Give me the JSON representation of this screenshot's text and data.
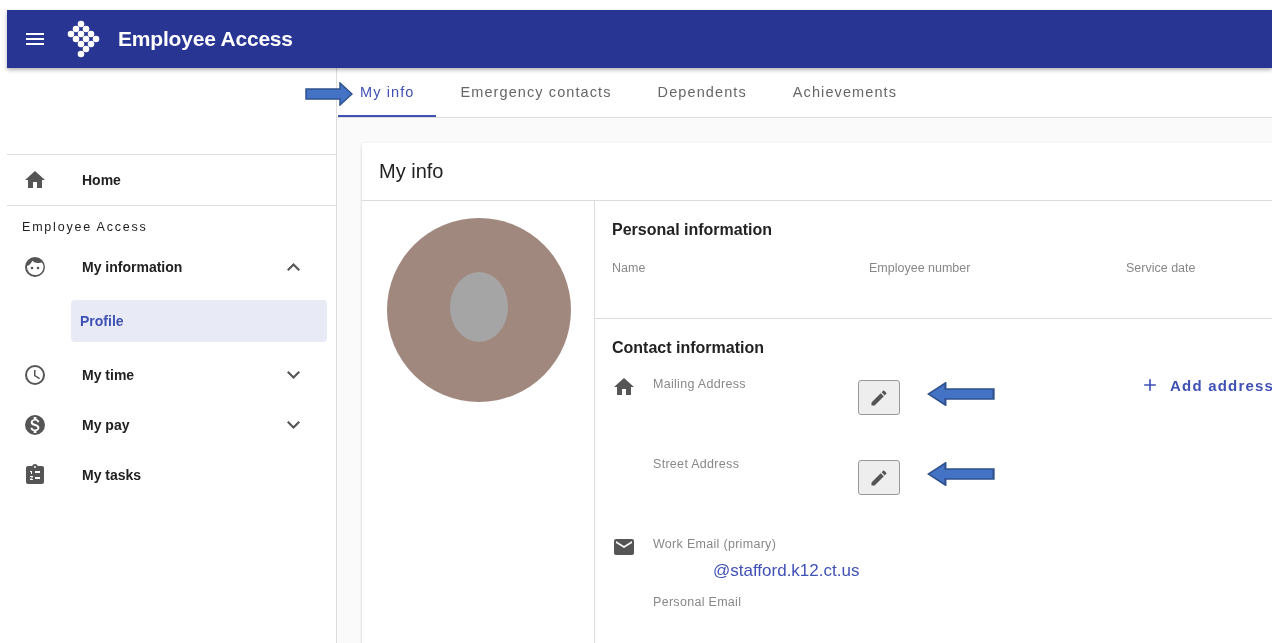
{
  "header": {
    "title": "Employee Access"
  },
  "tabs": [
    {
      "label": "My info",
      "selected": true
    },
    {
      "label": "Emergency contacts",
      "selected": false
    },
    {
      "label": "Dependents",
      "selected": false
    },
    {
      "label": "Achievements",
      "selected": false
    }
  ],
  "sidebar": {
    "top_items": [
      {
        "label": "Home",
        "selected": false
      }
    ],
    "section_title": "Employee Access",
    "items": [
      {
        "label": "My information",
        "selected": false,
        "expanded": true,
        "children": [
          {
            "label": "Profile",
            "selected": true
          }
        ]
      },
      {
        "label": "My time",
        "selected": false,
        "expanded": false
      },
      {
        "label": "My pay",
        "selected": false,
        "expanded": false
      },
      {
        "label": "My tasks",
        "selected": false
      }
    ]
  },
  "card": {
    "title": "My info",
    "personal": {
      "title": "Personal information",
      "fields": [
        "Name",
        "Employee number",
        "Service date"
      ]
    },
    "contact": {
      "title": "Contact information",
      "add_button": "Add address",
      "fields": [
        {
          "label": "Mailing Address",
          "kind": "address"
        },
        {
          "label": "Street Address",
          "kind": "address"
        },
        {
          "label": "Work Email (primary)",
          "kind": "email",
          "value": "@stafford.k12.ct.us"
        },
        {
          "label": "Personal Email",
          "kind": "email"
        }
      ]
    }
  }
}
